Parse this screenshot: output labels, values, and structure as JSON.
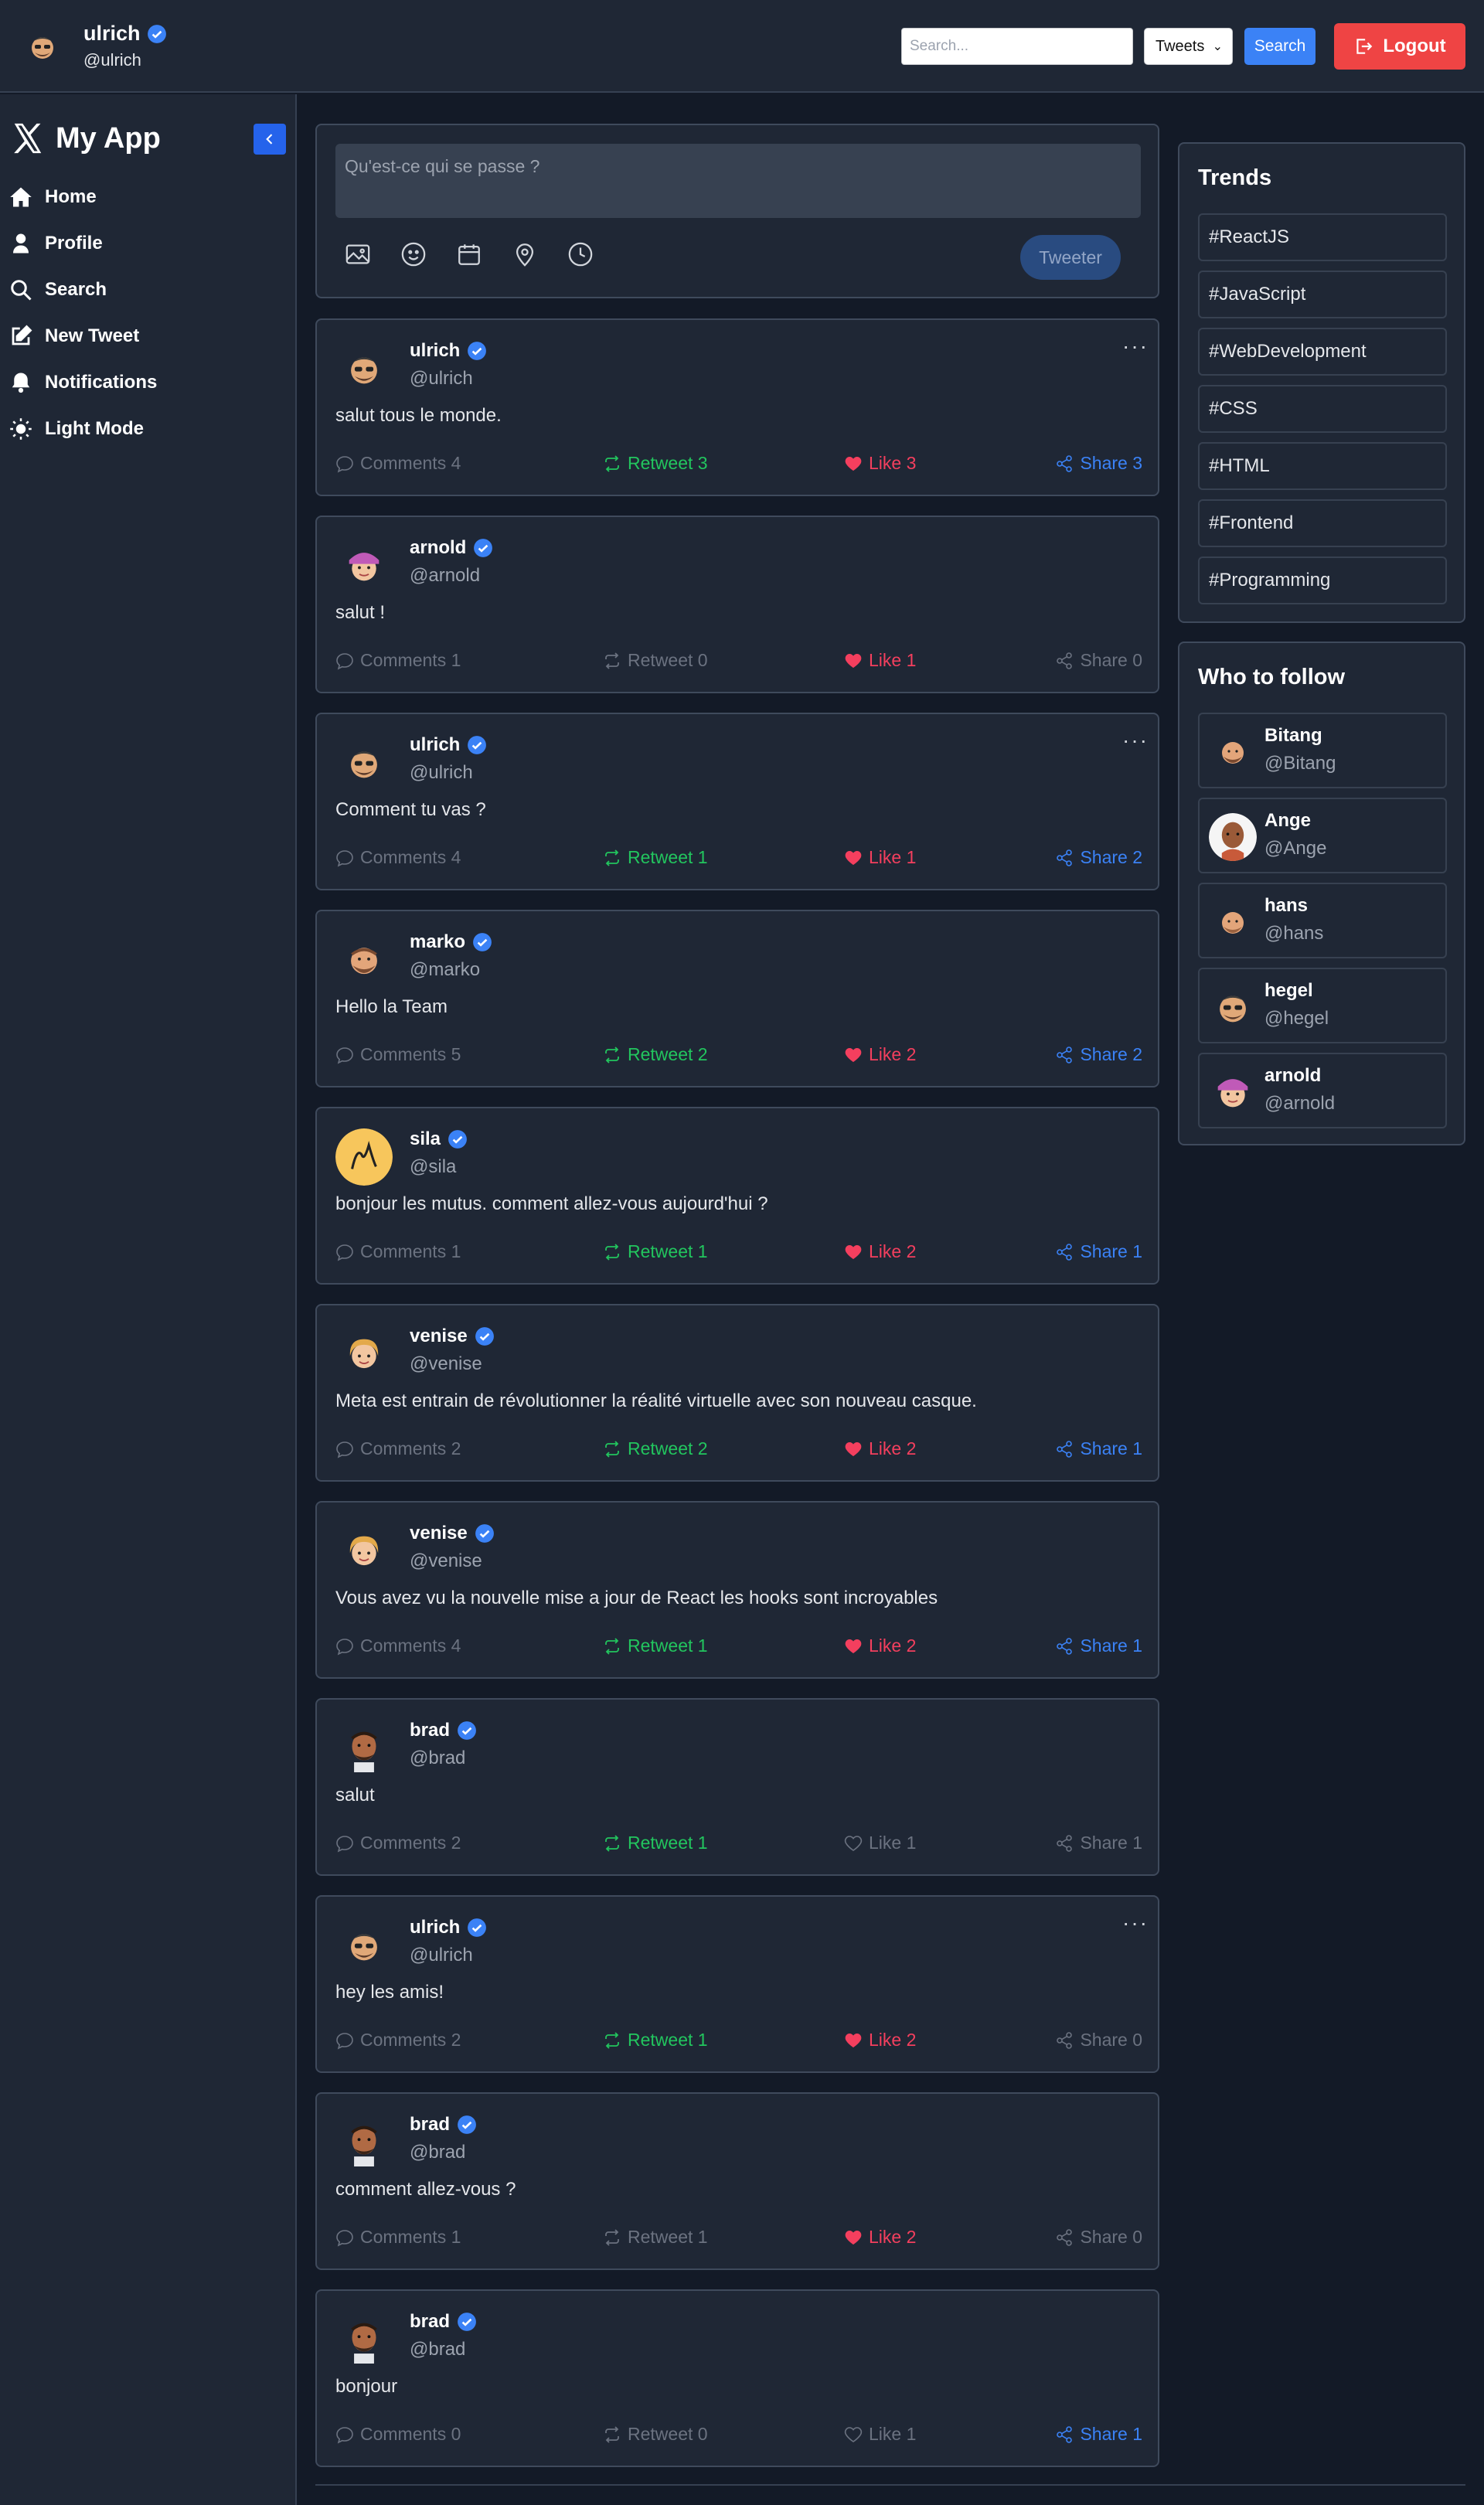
{
  "header": {
    "user_name": "ulrich",
    "user_handle": "@ulrich",
    "search_placeholder": "Search...",
    "search_type": "Tweets",
    "search_button": "Search",
    "logout_button": "Logout"
  },
  "sidebar": {
    "app_name": "My App",
    "items": [
      {
        "label": "Home",
        "icon": "home-icon"
      },
      {
        "label": "Profile",
        "icon": "user-icon"
      },
      {
        "label": "Search",
        "icon": "search-icon"
      },
      {
        "label": "New Tweet",
        "icon": "edit-icon"
      },
      {
        "label": "Notifications",
        "icon": "bell-icon"
      },
      {
        "label": "Light Mode",
        "icon": "sun-icon"
      }
    ]
  },
  "composer": {
    "placeholder": "Qu'est-ce qui se passe ?",
    "submit_label": "Tweeter"
  },
  "tweets": [
    {
      "name": "ulrich",
      "handle": "@ulrich",
      "content": "salut tous le monde.",
      "comments": "Comments 4",
      "retweet": "Retweet 3",
      "like": "Like 3",
      "share": "Share 3",
      "owner": true,
      "retweet_active": true,
      "like_active": true,
      "share_active": true
    },
    {
      "name": "arnold",
      "handle": "@arnold",
      "content": "salut !",
      "comments": "Comments 1",
      "retweet": "Retweet 0",
      "like": "Like 1",
      "share": "Share 0",
      "owner": false,
      "retweet_active": false,
      "like_active": true,
      "share_active": false
    },
    {
      "name": "ulrich",
      "handle": "@ulrich",
      "content": "Comment tu vas ?",
      "comments": "Comments 4",
      "retweet": "Retweet 1",
      "like": "Like 1",
      "share": "Share 2",
      "owner": true,
      "retweet_active": true,
      "like_active": true,
      "share_active": true
    },
    {
      "name": "marko",
      "handle": "@marko",
      "content": "Hello la Team",
      "comments": "Comments 5",
      "retweet": "Retweet 2",
      "like": "Like 2",
      "share": "Share 2",
      "owner": false,
      "retweet_active": true,
      "like_active": true,
      "share_active": true
    },
    {
      "name": "sila",
      "handle": "@sila",
      "content": "bonjour les mutus. comment allez-vous aujourd'hui ?",
      "comments": "Comments 1",
      "retweet": "Retweet 1",
      "like": "Like 2",
      "share": "Share 1",
      "owner": false,
      "retweet_active": true,
      "like_active": true,
      "share_active": true
    },
    {
      "name": "venise",
      "handle": "@venise",
      "content": "Meta est entrain de révolutionner la réalité virtuelle avec son nouveau casque.",
      "comments": "Comments 2",
      "retweet": "Retweet 2",
      "like": "Like 2",
      "share": "Share 1",
      "owner": false,
      "retweet_active": true,
      "like_active": true,
      "share_active": true
    },
    {
      "name": "venise",
      "handle": "@venise",
      "content": "Vous avez vu la nouvelle mise a jour de React les hooks sont incroyables",
      "comments": "Comments 4",
      "retweet": "Retweet 1",
      "like": "Like 2",
      "share": "Share 1",
      "owner": false,
      "retweet_active": true,
      "like_active": true,
      "share_active": true
    },
    {
      "name": "brad",
      "handle": "@brad",
      "content": "salut",
      "comments": "Comments 2",
      "retweet": "Retweet 1",
      "like": "Like 1",
      "share": "Share 1",
      "owner": false,
      "retweet_active": true,
      "like_active": false,
      "share_active": false
    },
    {
      "name": "ulrich",
      "handle": "@ulrich",
      "content": "hey les amis!",
      "comments": "Comments 2",
      "retweet": "Retweet 1",
      "like": "Like 2",
      "share": "Share 0",
      "owner": true,
      "retweet_active": true,
      "like_active": true,
      "share_active": false
    },
    {
      "name": "brad",
      "handle": "@brad",
      "content": "comment allez-vous ?",
      "comments": "Comments 1",
      "retweet": "Retweet 1",
      "like": "Like 2",
      "share": "Share 0",
      "owner": false,
      "retweet_active": false,
      "like_active": true,
      "share_active": false
    },
    {
      "name": "brad",
      "handle": "@brad",
      "content": "bonjour",
      "comments": "Comments 0",
      "retweet": "Retweet 0",
      "like": "Like 1",
      "share": "Share 1",
      "owner": false,
      "retweet_active": false,
      "like_active": false,
      "share_active": true
    }
  ],
  "trends": {
    "title": "Trends",
    "items": [
      "#ReactJS",
      "#JavaScript",
      "#WebDevelopment",
      "#CSS",
      "#HTML",
      "#Frontend",
      "#Programming"
    ]
  },
  "follow": {
    "title": "Who to follow",
    "items": [
      {
        "name": "Bitang",
        "handle": "@Bitang"
      },
      {
        "name": "Ange",
        "handle": "@Ange"
      },
      {
        "name": "hans",
        "handle": "@hans"
      },
      {
        "name": "hegel",
        "handle": "@hegel"
      },
      {
        "name": "arnold",
        "handle": "@arnold"
      }
    ]
  },
  "colors": {
    "background": "#131a27",
    "panel": "#1f2735",
    "accent": "#3b82f6",
    "danger": "#ef4444",
    "retweet": "#22c55e",
    "like": "#f43f5e",
    "muted": "#6b7280"
  }
}
